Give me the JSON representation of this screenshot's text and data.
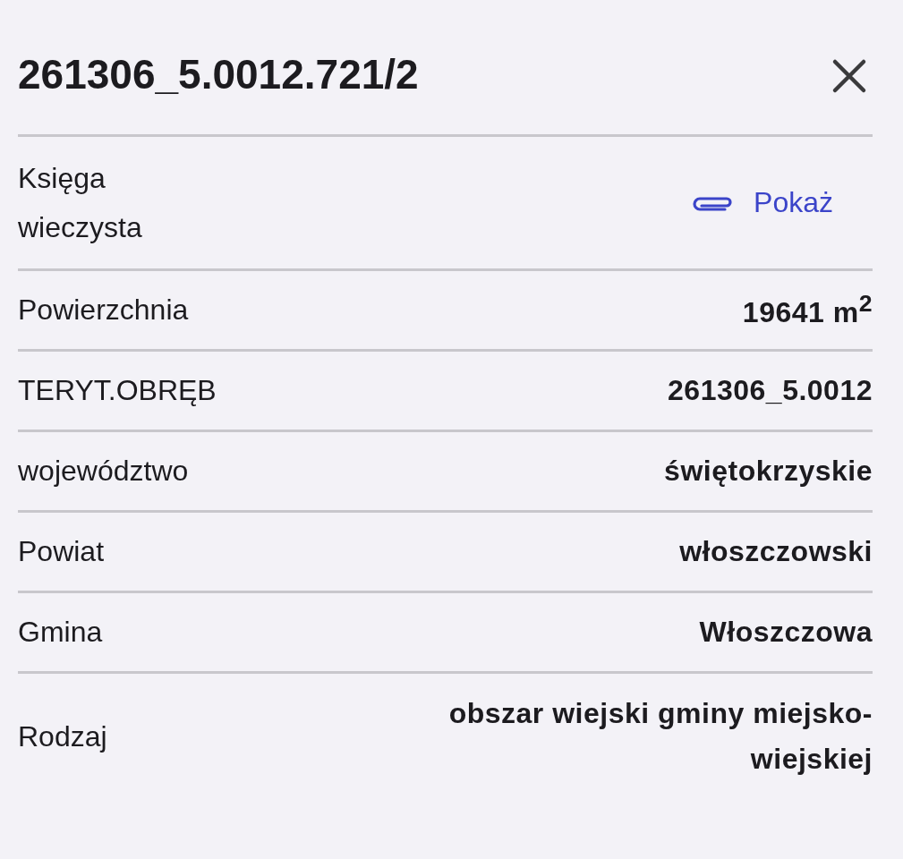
{
  "title": "261306_5.0012.721/2",
  "rows": [
    {
      "label": "Księga wieczysta",
      "kind": "link",
      "value": "Pokaż"
    },
    {
      "label": "Powierzchnia",
      "kind": "value",
      "value": "19641 m$^{2}$"
    },
    {
      "label": "TERYT.OBRĘB",
      "kind": "value",
      "value": "261306_5.0012"
    },
    {
      "label": "województwo",
      "kind": "value",
      "value": "świętokrzyskie"
    },
    {
      "label": "Powiat",
      "kind": "value",
      "value": "włoszczowski"
    },
    {
      "label": "Gmina",
      "kind": "value",
      "value": "Włoszczowa"
    },
    {
      "label": "Rodzaj",
      "kind": "value",
      "value": "obszar wiejski gminy miejsko-wiejskiej"
    }
  ]
}
